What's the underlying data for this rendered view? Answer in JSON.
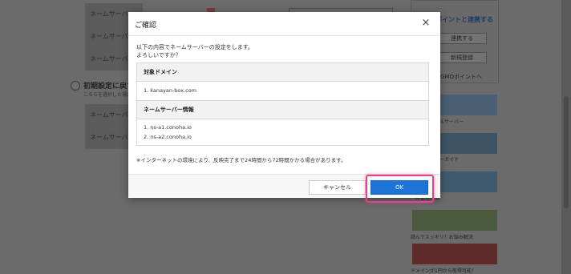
{
  "background": {
    "rows": [
      "ネームサーバー",
      "ネームサーバー",
      "ネームサーバー",
      "ネームサーバー",
      "ネームサーバー"
    ],
    "section_heading": "初期設定に戻す",
    "section_sub": "こちらを選択した場合",
    "sidebar": {
      "title": "ポイントと連携する",
      "link_button": "連携する",
      "register_button": "新規登録",
      "gmo_link": "GMOポイントへ",
      "banner_texts": [
        "ぱいのレンタルサーバー",
        "めてのサーバーガイド",
        "ーの管理方法",
        "読んでスッキリ！お悩み解決",
        "ドメインが1円から取得可能！"
      ]
    }
  },
  "dialog": {
    "title": "ご確認",
    "description_line1": "以下の内容でネームサーバーの設定をします。",
    "description_line2": "よろしいですか？",
    "domain_header": "対象ドメイン",
    "domain_value": "1. kanayan-box.com",
    "ns_header": "ネームサーバー情報",
    "ns_values": [
      "1. ns-a1.conoha.io",
      "2. ns-a2.conoha.io"
    ],
    "note": "※インターネットの環境により、反映完了まで24時間から72時間かかる場合があります。",
    "cancel_label": "キャンセル",
    "ok_label": "OK",
    "close_symbol": "×"
  },
  "colors": {
    "primary": "#1e73d8",
    "highlight": "#e0458a"
  }
}
